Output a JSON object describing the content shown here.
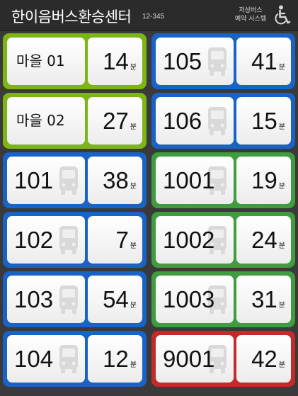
{
  "header": {
    "station_name": "한이음버스환승센터",
    "stop_id": "12-345",
    "lowfloor_line1": "저상버스",
    "lowfloor_line2": "예약 시스템",
    "wheelchair_icon": "wheelchair-icon"
  },
  "eta_unit": "분",
  "colors": {
    "village": "#7db517",
    "blue": "#1a63c6",
    "green": "#3f9c3f",
    "red": "#c42a2a"
  },
  "left_column": [
    {
      "route": "마을 01",
      "eta": "14",
      "type": "village"
    },
    {
      "route": "마을 02",
      "eta": "27",
      "type": "village"
    },
    {
      "route": "101",
      "eta": "38",
      "type": "blue"
    },
    {
      "route": "102",
      "eta": "7",
      "type": "blue"
    },
    {
      "route": "103",
      "eta": "54",
      "type": "blue"
    },
    {
      "route": "104",
      "eta": "12",
      "type": "blue"
    }
  ],
  "right_column": [
    {
      "route": "105",
      "eta": "41",
      "type": "blue"
    },
    {
      "route": "106",
      "eta": "15",
      "type": "blue"
    },
    {
      "route": "1001",
      "eta": "19",
      "type": "green"
    },
    {
      "route": "1002",
      "eta": "24",
      "type": "green"
    },
    {
      "route": "1003",
      "eta": "31",
      "type": "green"
    },
    {
      "route": "9001",
      "eta": "42",
      "type": "red"
    }
  ]
}
